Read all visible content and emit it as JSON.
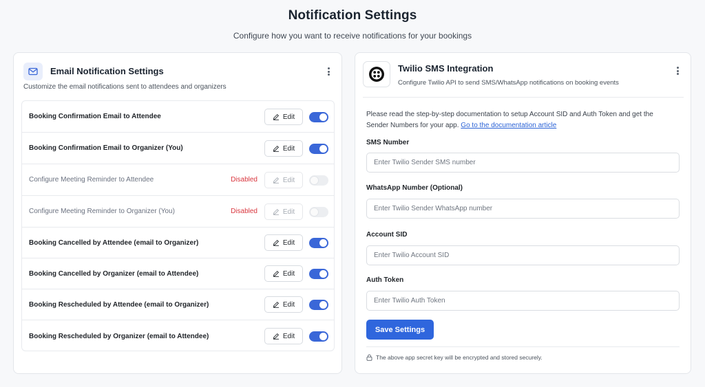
{
  "header": {
    "title": "Notification Settings",
    "subtitle": "Configure how you want to receive notifications for your bookings"
  },
  "email_card": {
    "icon": "mail-icon",
    "title": "Email Notification Settings",
    "description": "Customize the email notifications sent to attendees and organizers",
    "edit_label": "Edit",
    "rows": [
      {
        "label": "Booking Confirmation Email to Attendee",
        "status": "",
        "enabled": true
      },
      {
        "label": "Booking Confirmation Email to Organizer (You)",
        "status": "",
        "enabled": true
      },
      {
        "label": "Configure Meeting Reminder to Attendee",
        "status": "Disabled",
        "enabled": false
      },
      {
        "label": "Configure Meeting Reminder to Organizer (You)",
        "status": "Disabled",
        "enabled": false
      },
      {
        "label": "Booking Cancelled by Attendee (email to Organizer)",
        "status": "",
        "enabled": true
      },
      {
        "label": "Booking Cancelled by Organizer (email to Attendee)",
        "status": "",
        "enabled": true
      },
      {
        "label": "Booking Rescheduled by Attendee (email to Organizer)",
        "status": "",
        "enabled": true
      },
      {
        "label": "Booking Rescheduled by Organizer (email to Attendee)",
        "status": "",
        "enabled": true
      }
    ]
  },
  "sms_card": {
    "icon": "twilio-logo-icon",
    "title": "Twilio SMS Integration",
    "description": "Configure Twilio API to send SMS/WhatsApp notifications on booking events",
    "doc_text": "Please read the step-by-step documentation to setup Account SID and Auth Token and get the Sender Numbers for your app.",
    "doc_link": "Go to the documentation article",
    "fields": {
      "sms": {
        "label": "SMS Number",
        "placeholder": "Enter Twilio Sender SMS number"
      },
      "whatsapp": {
        "label": "WhatsApp Number (Optional)",
        "placeholder": "Enter Twilio Sender WhatsApp number"
      },
      "sid": {
        "label": "Account SID",
        "placeholder": "Enter Twilio Account SID"
      },
      "token": {
        "label": "Auth Token",
        "placeholder": "Enter Twilio Auth Token"
      }
    },
    "save_label": "Save Settings",
    "secure_note": "The above app secret key will be encrypted and stored securely."
  },
  "colors": {
    "accent": "#2f66dd",
    "toggle_on": "#3a67d8",
    "disabled_status": "#d9363e"
  }
}
